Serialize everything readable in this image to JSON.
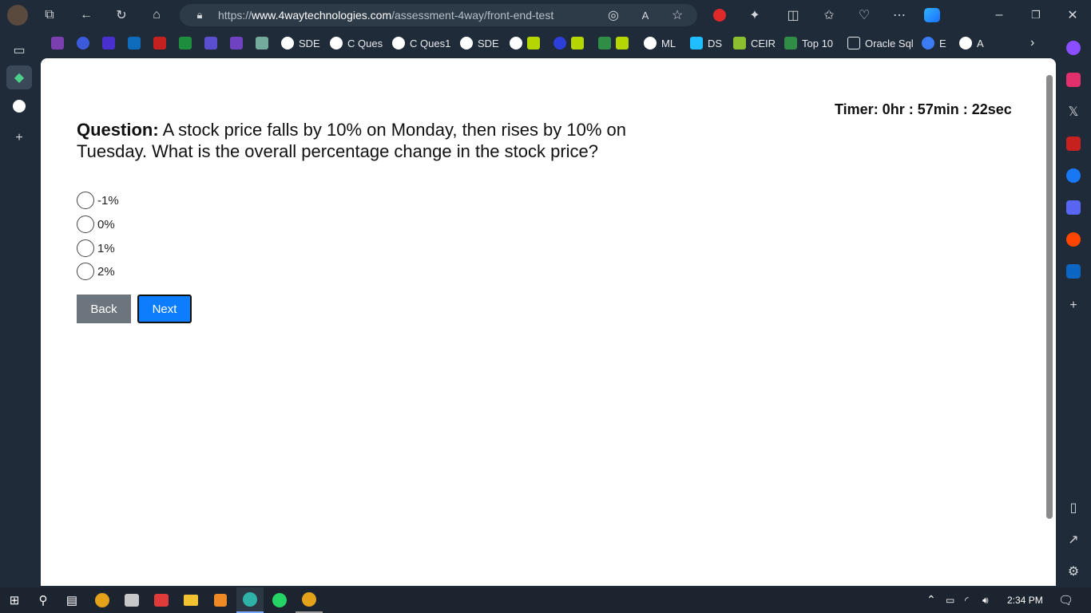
{
  "browser": {
    "url_prefix": "https://",
    "url_domain": "www.4waytechnologies.com",
    "url_path": "/assessment-4way/front-end-test",
    "bookmarks": [
      "SDE",
      "C Ques",
      "C Ques1",
      "SDE",
      "ML",
      "DS",
      "CEIR",
      "Top 10",
      "Oracle Sql",
      "E",
      "A"
    ]
  },
  "test": {
    "timer": "Timer: 0hr : 57min : 22sec",
    "question_label": "Question:",
    "question_text": " A stock price falls by 10% on Monday, then rises by 10% on Tuesday. What is the overall percentage change in the stock price?",
    "options": [
      "-1%",
      "0%",
      "1%",
      "2%"
    ],
    "back_label": "Back",
    "next_label": "Next"
  },
  "taskbar": {
    "time": "2:34 PM"
  },
  "colors": {
    "next_button": "#0d7dfd",
    "back_button": "#6c757d",
    "chrome_bg": "#1f2b38"
  }
}
